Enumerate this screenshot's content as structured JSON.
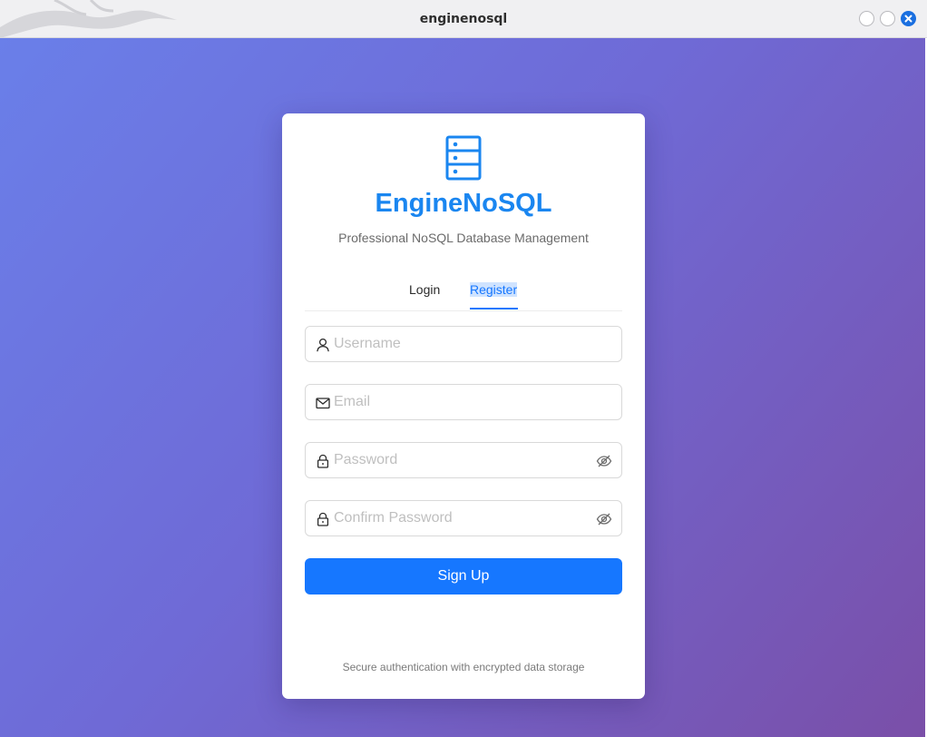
{
  "window": {
    "title": "enginenosql",
    "controls": [
      "minimize",
      "maximize",
      "close"
    ]
  },
  "brand": {
    "name": "EngineNoSQL",
    "tagline": "Professional NoSQL Database Management",
    "icon": "server-icon",
    "color": "#1a86f0"
  },
  "tabs": {
    "login": "Login",
    "register": "Register",
    "active": "register"
  },
  "form": {
    "username": {
      "placeholder": "Username",
      "value": "",
      "icon": "user-icon"
    },
    "email": {
      "placeholder": "Email",
      "value": "",
      "icon": "mail-icon"
    },
    "password": {
      "placeholder": "Password",
      "value": "",
      "icon": "lock-icon"
    },
    "confirm_password": {
      "placeholder": "Confirm Password",
      "value": "",
      "icon": "lock-icon"
    },
    "submit_label": "Sign Up"
  },
  "footer": {
    "note": "Secure authentication with encrypted data storage"
  },
  "colors": {
    "accent": "#1677ff",
    "background_start": "#6a7fe9",
    "background_end": "#7a4fa8"
  }
}
